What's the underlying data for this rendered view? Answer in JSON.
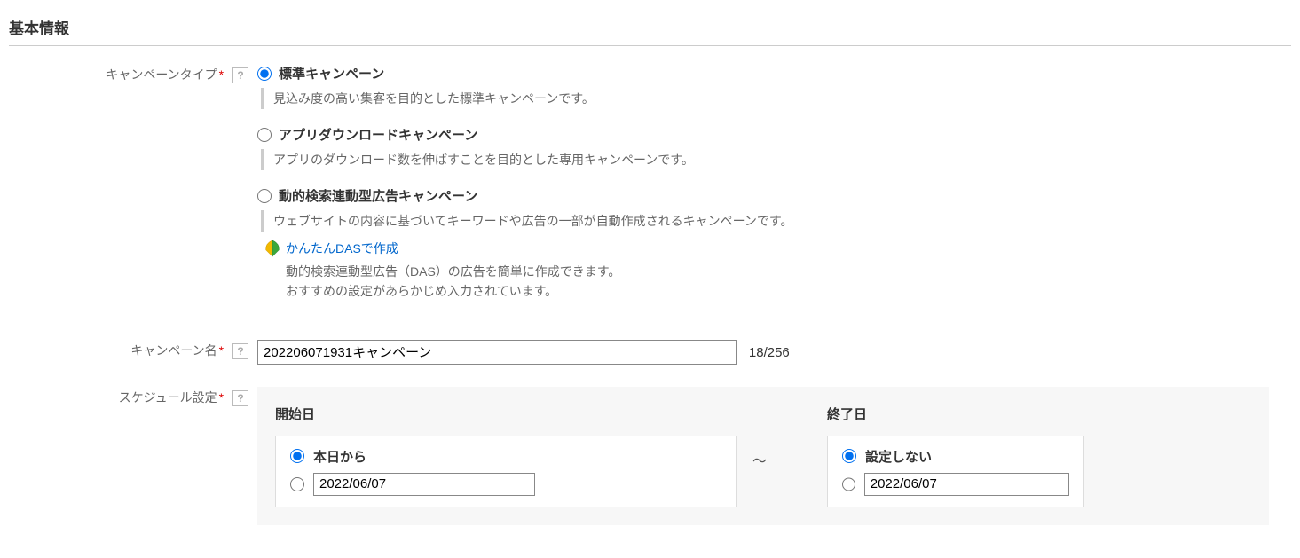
{
  "section_title": "基本情報",
  "labels": {
    "campaign_type": "キャンペーンタイプ",
    "campaign_name": "キャンペーン名",
    "schedule": "スケジュール設定"
  },
  "required_mark": "*",
  "campaign_type": {
    "options": [
      {
        "label": "標準キャンペーン",
        "desc": "見込み度の高い集客を目的とした標準キャンペーンです。",
        "selected": true
      },
      {
        "label": "アプリダウンロードキャンペーン",
        "desc": "アプリのダウンロード数を伸ばすことを目的とした専用キャンペーンです。",
        "selected": false
      },
      {
        "label": "動的検索連動型広告キャンペーン",
        "desc": "ウェブサイトの内容に基づいてキーワードや広告の一部が自動作成されるキャンペーンです。",
        "selected": false
      }
    ],
    "das_link": "かんたんDASで作成",
    "das_sub1": "動的検索連動型広告（DAS）の広告を簡単に作成できます。",
    "das_sub2": "おすすめの設定があらかじめ入力されています。"
  },
  "campaign_name": {
    "value": "202206071931キャンペーン",
    "counter": "18/256"
  },
  "schedule": {
    "start_title": "開始日",
    "end_title": "終了日",
    "tilde": "～",
    "start": {
      "opt_today": "本日から",
      "date_value": "2022/06/07",
      "selected": "today"
    },
    "end": {
      "opt_none": "設定しない",
      "date_value": "2022/06/07",
      "selected": "none"
    }
  }
}
